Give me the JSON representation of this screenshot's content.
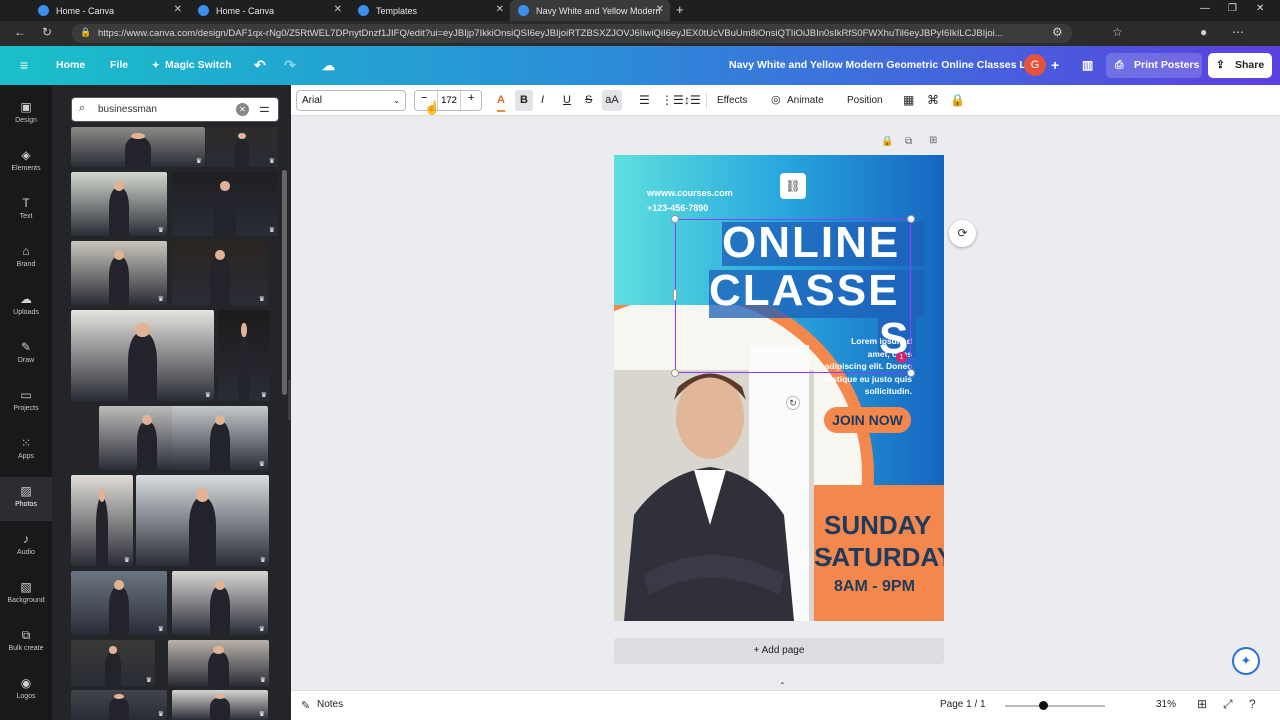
{
  "browser": {
    "tabs": [
      {
        "label": "Home - Canva"
      },
      {
        "label": "Home - Canva"
      },
      {
        "label": "Templates"
      },
      {
        "label": "Navy White and Yellow Modern"
      }
    ],
    "url": "https://www.canva.com/design/DAF1qx-rNg0/Z5RtWEL7DPnytDnzf1JIFQ/edit?ui=eyJBIjp7IkkiOnsiQSI6eyJBIjoiRTZBSXZJOVJ6IiwiQiI6eyJEX0tUcVBuUm8iOnsiQTIiOiJBIn0sIkRfS0FWXhuTil6eyJBPyI6IkILCJBIjoi..."
  },
  "header": {
    "home": "Home",
    "file": "File",
    "magic_switch": "Magic Switch",
    "doc_title": "Navy White and Yellow Modern Geometric Online Classes L...",
    "avatar_letter": "G",
    "print": "Print Posters",
    "share": "Share"
  },
  "rail": [
    {
      "label": "Design",
      "icon": "layout-icon"
    },
    {
      "label": "Elements",
      "icon": "shapes-icon"
    },
    {
      "label": "Text",
      "icon": "text-icon"
    },
    {
      "label": "Brand",
      "icon": "brand-icon"
    },
    {
      "label": "Uploads",
      "icon": "cloud-upload-icon"
    },
    {
      "label": "Draw",
      "icon": "pen-icon"
    },
    {
      "label": "Projects",
      "icon": "folder-icon"
    },
    {
      "label": "Apps",
      "icon": "grid-icon"
    },
    {
      "label": "Photos",
      "icon": "image-icon"
    },
    {
      "label": "Audio",
      "icon": "music-icon"
    },
    {
      "label": "Background",
      "icon": "pattern-icon"
    },
    {
      "label": "Bulk create",
      "icon": "bulk-icon"
    },
    {
      "label": "Logos",
      "icon": "logo-icon"
    }
  ],
  "panel": {
    "search_value": "businessman"
  },
  "toolbar": {
    "font": "Arial",
    "font_size": "172",
    "minus": "−",
    "plus": "+",
    "effects": "Effects",
    "animate": "Animate",
    "position": "Position"
  },
  "poster": {
    "website": "wwww.courses.com",
    "phone": "+123-456-7890",
    "title_line1": "ONLINE",
    "title_line2": "CLASSE",
    "title_line3": "S",
    "body_text": "Lorem ipsum d... amet, cons... adipiscing elit. Donec tristique eu justo quis sollicitudin.",
    "body_lines": [
      "Lorem ipsum d",
      "amet, cons",
      "adipiscing elit. Donec",
      "tristique eu justo quis",
      "sollicitudin."
    ],
    "cta": "JOIN NOW",
    "days_line1": "SUNDAY -",
    "days_line2": "SATURDAY",
    "hours": "8AM - 9PM",
    "badge": "1"
  },
  "canvas": {
    "add_page": "+ Add page"
  },
  "footer": {
    "notes": "Notes",
    "page": "Page 1 / 1",
    "zoom": "31%"
  },
  "colors": {
    "accent_purple": "#8b3dff",
    "poster_orange": "#f4874b",
    "poster_navy": "#1d3a5f"
  }
}
